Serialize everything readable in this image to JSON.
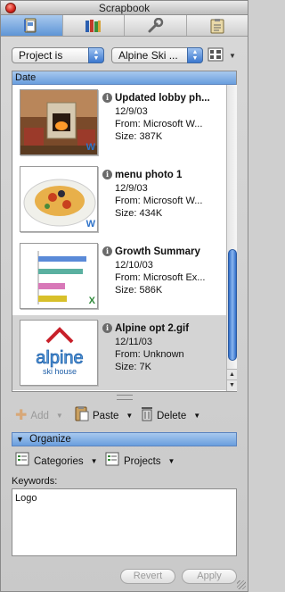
{
  "window": {
    "title": "Scrapbook"
  },
  "toolbar": {
    "tabs": [
      {
        "icon": "scrapbook-icon",
        "active": true
      },
      {
        "icon": "books-icon",
        "active": false
      },
      {
        "icon": "wrench-icon",
        "active": false
      },
      {
        "icon": "clipboard-icon",
        "active": false
      }
    ]
  },
  "filter": {
    "field": "Project is",
    "value": "Alpine Ski ...",
    "view_icon": "grid-view-icon"
  },
  "list": {
    "column_header": "Date",
    "items": [
      {
        "name": "Updated lobby ph...",
        "date": "12/9/03",
        "from": "From: Microsoft W...",
        "size": "Size: 387K",
        "thumb": "lobby-photo",
        "badge": "W"
      },
      {
        "name": "menu photo 1",
        "date": "12/9/03",
        "from": "From: Microsoft W...",
        "size": "Size: 434K",
        "thumb": "pasta-photo",
        "badge": "W"
      },
      {
        "name": "Growth Summary",
        "date": "12/10/03",
        "from": "From: Microsoft Ex...",
        "size": "Size: 586K",
        "thumb": "bar-chart",
        "badge": "X"
      },
      {
        "name": "Alpine opt 2.gif",
        "date": "12/11/03",
        "from": "From: Unknown",
        "size": "Size: 7K",
        "thumb": "alpine-logo",
        "selected": true
      }
    ]
  },
  "logo": {
    "line1": "alpine",
    "line2": "ski house"
  },
  "actions": {
    "add": "Add",
    "paste": "Paste",
    "delete": "Delete"
  },
  "organize": {
    "title": "Organize",
    "categories": "Categories",
    "projects": "Projects"
  },
  "keywords": {
    "label": "Keywords:",
    "value": "Logo"
  },
  "buttons": {
    "revert": "Revert",
    "apply": "Apply"
  },
  "colors": {
    "accent": "#5e95d6",
    "selection": "#d4d4d4"
  }
}
